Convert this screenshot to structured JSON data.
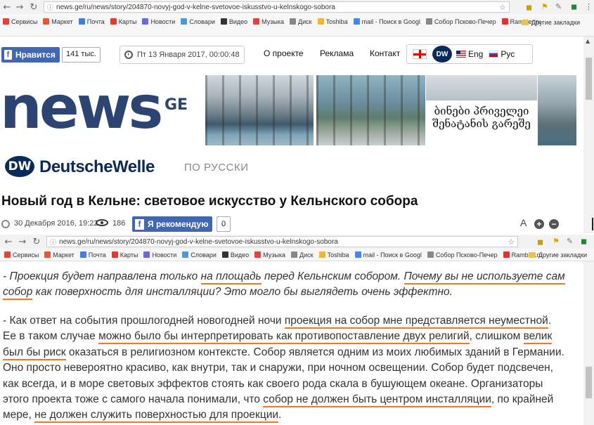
{
  "browser": {
    "url": "news.ge/ru/news/story/204870-novyj-god-v-kelne-svetovoe-iskusstvo-u-kelnskogo-sobora",
    "bookmarks": [
      {
        "label": "Сервисы",
        "color": "#d44"
      },
      {
        "label": "Маркет",
        "color": "#e53"
      },
      {
        "label": "Почта",
        "color": "#4a7bd6"
      },
      {
        "label": "Карты",
        "color": "#e33"
      },
      {
        "label": "Новости",
        "color": "#6b6bd6"
      },
      {
        "label": "Словари",
        "color": "#4a9bd6"
      },
      {
        "label": "Видео",
        "color": "#333"
      },
      {
        "label": "Музыка",
        "color": "#d44"
      },
      {
        "label": "Диск",
        "color": "#888"
      },
      {
        "label": "Toshiba",
        "color": "#e9b838"
      },
      {
        "label": "mail - Поиск в Googl",
        "color": "#4285f4"
      },
      {
        "label": "Собор Псково-Печер",
        "color": "#888"
      },
      {
        "label": "Rambler.ru",
        "color": "#d33"
      }
    ],
    "other_bookmarks": "Другие закладки"
  },
  "header": {
    "like_label": "Нравится",
    "like_count": "141 тыс.",
    "date": "Пт 13 Января 2017, 00:00:48",
    "menu": [
      "О проекте",
      "Реклама",
      "Контакт"
    ],
    "dw_badge": "DW",
    "lang_en": "Eng",
    "lang_ru": "Рус"
  },
  "banner": {
    "logo": "news",
    "logo_suffix": "GE",
    "geo_line1": "ბინები პრიველეი",
    "geo_line2": "შენატანის გარეშე"
  },
  "dw": {
    "mark": "DW",
    "name": "DeutscheWelle",
    "subtitle": "ПО РУССКИ"
  },
  "article": {
    "title": "Новый год в Кельне: световое искусство у Кельнского собора",
    "date": "30 Декабря 2016, 19:22",
    "views": "186",
    "recommend_label": "Я рекомендую",
    "recommend_count": "0",
    "font_a": "A",
    "font_plus": "+",
    "font_minus": "−",
    "p1": {
      "t1": "- Проекция будет направлена только ",
      "u1": "на площадь",
      "t2": " перед Кельнским собором. ",
      "u2": "Почему вы не используете сам собор",
      "t3": " как поверхность для инсталляции? Это могло бы выглядеть очень эффектно."
    },
    "p2": {
      "t1": "- Как ответ на события прошлогодней новогодней ночи ",
      "u1": "проекция на собор мне представляется неуместной",
      "t2": ". Ее в таком случае ",
      "u2": "можно было бы интерпретировать как противопоставление двух религий",
      "t3": ", слишком ",
      "u3": "велик был бы риск",
      "t4": " оказаться в религиозном контексте. Собор является одним из моих любимых зданий в Германии. Оно просто невероятно красиво, как внутри, так и снаружи, при ночном освещении. Собор будет подсвечен, как всегда, и в море световых эффектов стоять как своего рода скала в бушующем океане. Организаторы этого проекта тоже с самого начала понимали, что ",
      "u4": "собор не должен быть центром инсталляции",
      "t5": ", по крайней мере, ",
      "u5": "не должен служить поверхностью для проекции",
      "t6": "."
    }
  }
}
